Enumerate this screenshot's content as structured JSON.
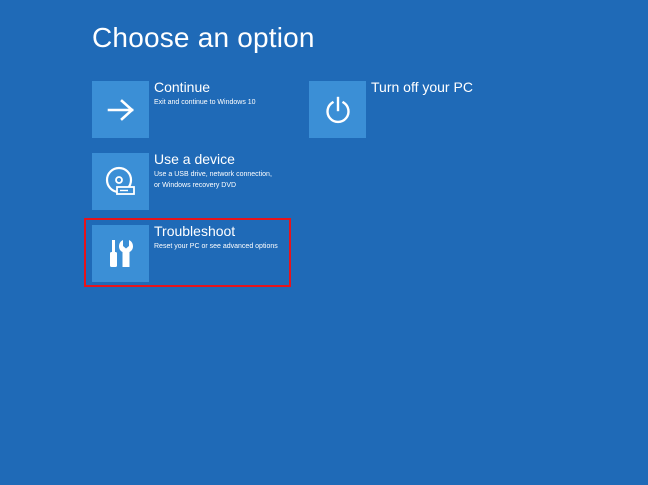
{
  "screen": {
    "title": "Choose an option"
  },
  "options": {
    "continue": {
      "title": "Continue",
      "description": "Exit and continue to Windows 10",
      "icon": "arrow-right-icon"
    },
    "device": {
      "title": "Use a device",
      "description": "Use a USB drive, network connection,\nor Windows recovery DVD",
      "icon": "disc-drive-icon"
    },
    "troubleshoot": {
      "title": "Troubleshoot",
      "description": "Reset your PC or see advanced options",
      "icon": "tools-icon"
    },
    "poweroff": {
      "title": "Turn off your PC",
      "icon": "power-icon"
    }
  },
  "colors": {
    "background": "#1f6ab7",
    "tile": "#3b8fd6",
    "highlight": "#e8141b",
    "text": "#ffffff"
  }
}
